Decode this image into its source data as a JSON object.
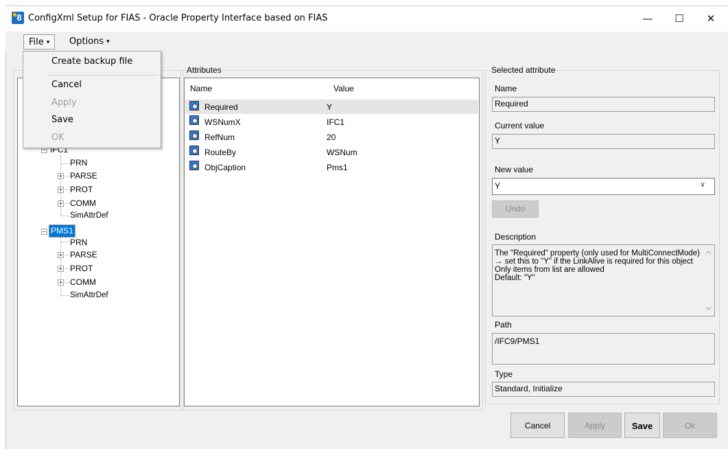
{
  "window": {
    "title": "ConfigXml Setup for FIAS - Oracle Property Interface based on FIAS",
    "app_icon_text": "8",
    "minimize_glyph": "—",
    "maximize_glyph": "☐",
    "close_glyph": "✕"
  },
  "menubar": {
    "file": "File",
    "options": "Options",
    "caret": "▾"
  },
  "file_menu": {
    "items": [
      {
        "label": "Create backup file",
        "enabled": true
      },
      {
        "label": "Cancel",
        "enabled": true
      },
      {
        "label": "Apply",
        "enabled": false
      },
      {
        "label": "Save",
        "enabled": true
      },
      {
        "label": "OK",
        "enabled": false
      }
    ]
  },
  "tree": {
    "exp_plus": "+",
    "exp_minus": "−",
    "nodes": [
      {
        "label": "IFC1",
        "level": 0,
        "expanded": true
      },
      {
        "label": "PRN",
        "level": 1
      },
      {
        "label": "PARSE",
        "level": 1,
        "expandable": true
      },
      {
        "label": "PROT",
        "level": 1,
        "expandable": true
      },
      {
        "label": "COMM",
        "level": 1,
        "expandable": true
      },
      {
        "label": "SimAttrDef",
        "level": 1
      },
      {
        "label": "PMS1",
        "level": 0,
        "expanded": true,
        "selected": true
      },
      {
        "label": "PRN",
        "level": 1
      },
      {
        "label": "PARSE",
        "level": 1,
        "expandable": true
      },
      {
        "label": "PROT",
        "level": 1,
        "expandable": true
      },
      {
        "label": "COMM",
        "level": 1,
        "expandable": true
      },
      {
        "label": "SimAttrDef",
        "level": 1
      }
    ]
  },
  "attributes": {
    "group_title": "Attributes",
    "columns": [
      "Name",
      "Value"
    ],
    "rows": [
      {
        "name": "Required",
        "value": "Y",
        "selected": true
      },
      {
        "name": "WSNumX",
        "value": "IFC1"
      },
      {
        "name": "RefNum",
        "value": "20"
      },
      {
        "name": "RouteBy",
        "value": "WSNum"
      },
      {
        "name": "ObjCaption",
        "value": "Pms1"
      }
    ]
  },
  "selected_attribute": {
    "group_title": "Selected attribute",
    "name_label": "Name",
    "name_value": "Required",
    "current_label": "Current value",
    "current_value": "Y",
    "new_label": "New value",
    "new_value": "Y",
    "dropdown_glyph": "∨",
    "undo": "Undo",
    "description_label": "Description",
    "description": "The \"Required\" property (only used for MultiConnectMode) → set this to \"Y\" if the LinkAlive is required for this object\nOnly items from list are allowed\nDefault: \"Y\"",
    "path_label": "Path",
    "path_value": "/IFC9/PMS1",
    "type_label": "Type",
    "type_value": "Standard, Initialize"
  },
  "buttons": {
    "cancel": "Cancel",
    "apply": "Apply",
    "save": "Save",
    "ok": "Ok"
  },
  "colors": {
    "selection": "#0078d7",
    "window_bg": "#f0f0f0"
  }
}
